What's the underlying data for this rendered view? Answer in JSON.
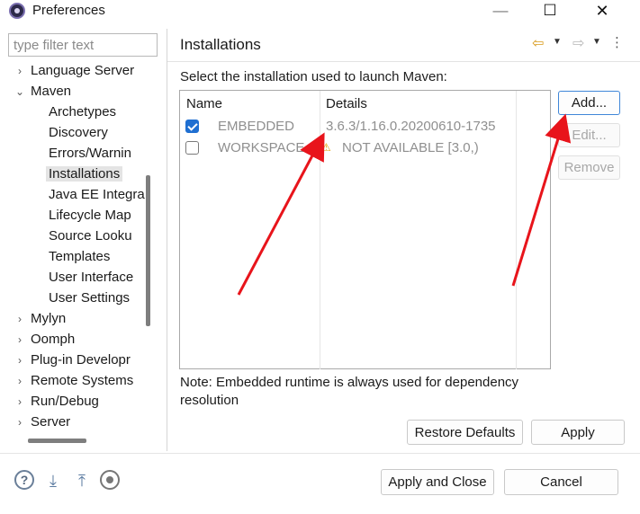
{
  "window": {
    "title": "Preferences",
    "minimize": "—",
    "maximize": "☐",
    "close": "✕"
  },
  "sidebar": {
    "filter_placeholder": "type filter text",
    "items": [
      {
        "label": "Language Server",
        "chevron": "›",
        "level": 0
      },
      {
        "label": "Maven",
        "chevron": "⌄",
        "level": 0
      },
      {
        "label": "Archetypes",
        "chevron": "",
        "level": 1
      },
      {
        "label": "Discovery",
        "chevron": "",
        "level": 1
      },
      {
        "label": "Errors/Warnin",
        "chevron": "",
        "level": 1
      },
      {
        "label": "Installations",
        "chevron": "",
        "level": 1,
        "selected": true
      },
      {
        "label": "Java EE Integra",
        "chevron": "",
        "level": 1
      },
      {
        "label": "Lifecycle Map",
        "chevron": "",
        "level": 1
      },
      {
        "label": "Source Looku",
        "chevron": "",
        "level": 1
      },
      {
        "label": "Templates",
        "chevron": "",
        "level": 1
      },
      {
        "label": "User Interface",
        "chevron": "",
        "level": 1
      },
      {
        "label": "User Settings",
        "chevron": "",
        "level": 1
      },
      {
        "label": "Mylyn",
        "chevron": "›",
        "level": 0
      },
      {
        "label": "Oomph",
        "chevron": "›",
        "level": 0
      },
      {
        "label": "Plug-in Developr",
        "chevron": "›",
        "level": 0
      },
      {
        "label": "Remote Systems",
        "chevron": "›",
        "level": 0
      },
      {
        "label": "Run/Debug",
        "chevron": "›",
        "level": 0
      },
      {
        "label": "Server",
        "chevron": "›",
        "level": 0
      }
    ]
  },
  "header": {
    "title": "Installations",
    "back_icon": "⇦",
    "forward_icon": "⇨",
    "dropdown": "▼",
    "menu": "⋮"
  },
  "main": {
    "select_label": "Select the installation used to launch Maven:",
    "columns": [
      "Name",
      "Details"
    ],
    "rows": [
      {
        "checked": true,
        "name": "EMBEDDED",
        "details": "3.6.3/1.16.0.20200610-1735",
        "warning": false
      },
      {
        "checked": false,
        "name": "WORKSPACE",
        "details": "NOT AVAILABLE [3.0,)",
        "warning": true
      }
    ],
    "warning_glyph": "⚠",
    "buttons": {
      "add": "Add...",
      "edit": "Edit...",
      "remove": "Remove"
    },
    "note": "Note: Embedded runtime is always used for dependency resolution",
    "restore_defaults": "Restore Defaults",
    "apply": "Apply"
  },
  "footer": {
    "help_glyph": "?",
    "import_glyph": "⤓",
    "export_glyph": "⤒",
    "apply_and_close": "Apply and Close",
    "cancel": "Cancel"
  },
  "colors": {
    "accent": "#1f6fd1",
    "arrow": "#e8141b",
    "warning": "#e0a000"
  }
}
